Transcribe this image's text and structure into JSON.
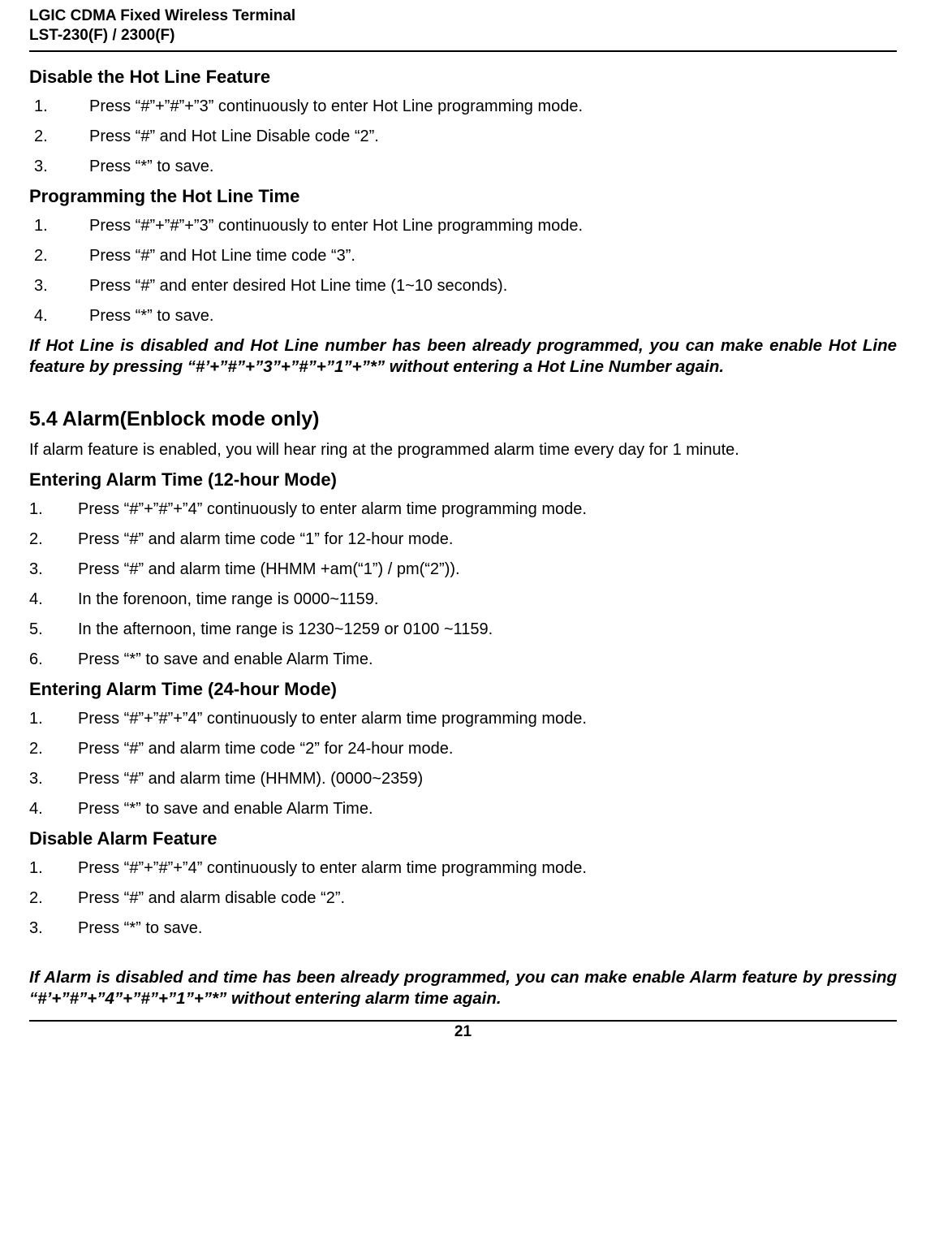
{
  "header": {
    "line1": "LGIC CDMA Fixed Wireless Terminal",
    "line2": "LST-230(F) / 2300(F)"
  },
  "footer": {
    "page": "21"
  },
  "sections": {
    "disableHotLine": {
      "title": "Disable the Hot Line Feature",
      "steps": [
        "Press “#”+”#”+”3” continuously to enter Hot Line programming mode.",
        "Press “#” and Hot Line Disable code “2”.",
        "Press “*” to save."
      ]
    },
    "progHotLineTime": {
      "title": "Programming the Hot Line Time",
      "steps": [
        "Press “#”+”#”+”3” continuously to enter Hot Line programming mode.",
        "Press “#” and Hot Line time code “3”.",
        "Press “#” and enter desired Hot Line time (1~10 seconds).",
        "Press “*” to save."
      ]
    },
    "hotLineNote": "If Hot Line is disabled and Hot Line number has been already programmed, you can make enable Hot Line feature by pressing “#’+”#”+”3”+”#”+”1”+”*” without entering a Hot Line Number again.",
    "alarm": {
      "title": "5.4  Alarm(Enblock mode only)",
      "intro": "If alarm feature is enabled, you will hear ring at the programmed alarm time every day for 1 minute."
    },
    "alarm12": {
      "title": "Entering Alarm Time (12-hour Mode)",
      "steps": [
        "Press “#”+”#”+”4” continuously to enter alarm time programming mode.",
        "Press “#” and alarm time code “1” for 12-hour mode.",
        "Press “#” and alarm time (HHMM +am(“1”) / pm(“2”)).",
        "In the forenoon, time range is 0000~1159.",
        "In the afternoon, time range is 1230~1259 or 0100 ~1159.",
        "Press “*” to save and enable Alarm Time."
      ]
    },
    "alarm24": {
      "title": "Entering Alarm Time (24-hour Mode)",
      "steps": [
        "Press “#”+”#”+”4” continuously to enter alarm time programming mode.",
        "Press “#” and alarm time code “2” for 24-hour mode.",
        "Press “#” and alarm time (HHMM). (0000~2359)",
        "Press “*” to save and enable Alarm Time."
      ]
    },
    "disableAlarm": {
      "title": "Disable Alarm Feature",
      "steps": [
        "Press “#”+”#”+”4” continuously to enter alarm time programming mode.",
        "Press “#” and alarm disable code “2”.",
        "Press “*” to save."
      ]
    },
    "alarmNote": "If Alarm is disabled and time has been already programmed, you can make enable Alarm feature by pressing “#’+”#”+”4”+”#”+”1”+”*” without entering alarm time again."
  }
}
